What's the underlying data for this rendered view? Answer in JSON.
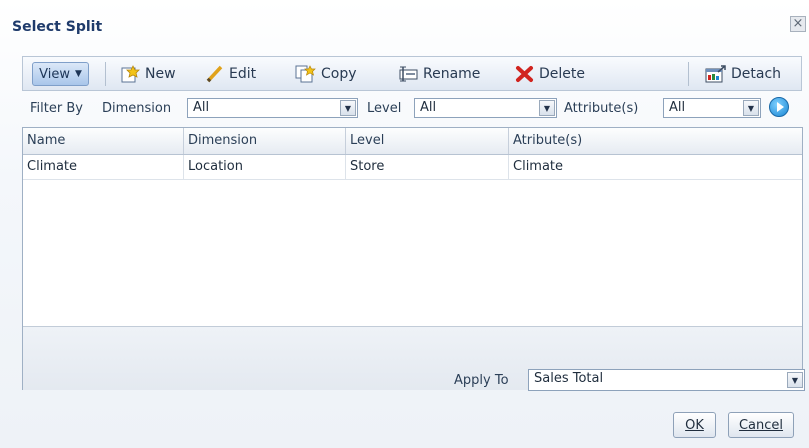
{
  "dialog": {
    "title": "Select Split",
    "close_glyph": "×"
  },
  "toolbar": {
    "view_label": "View",
    "new_label": "New",
    "edit_label": "Edit",
    "copy_label": "Copy",
    "rename_label": "Rename",
    "delete_label": "Delete",
    "detach_label": "Detach"
  },
  "filter": {
    "filter_by_label": "Filter By",
    "dimension_label": "Dimension",
    "dimension_value": "All",
    "level_label": "Level",
    "level_value": "All",
    "attribute_label": "Attribute(s)",
    "attribute_value": "All"
  },
  "table": {
    "columns": [
      "Name",
      "Dimension",
      "Level",
      "Atribute(s)"
    ],
    "rows": [
      [
        "Climate",
        "Location",
        "Store",
        "Climate"
      ]
    ]
  },
  "apply": {
    "label": "Apply To",
    "value": "Sales Total"
  },
  "buttons": {
    "ok_label": "OK",
    "cancel_label": "Cancel"
  },
  "icons": {
    "new": "new-icon",
    "edit": "pencil-icon",
    "copy": "copy-icon",
    "rename": "rename-icon",
    "delete": "delete-x-icon",
    "detach": "detach-icon",
    "go": "go-arrow-icon",
    "dropdown": "chevron-down-icon"
  },
  "colors": {
    "delete_red": "#d1241f",
    "go_blue": "#1a86d3",
    "accent": "#1f3b6b"
  }
}
